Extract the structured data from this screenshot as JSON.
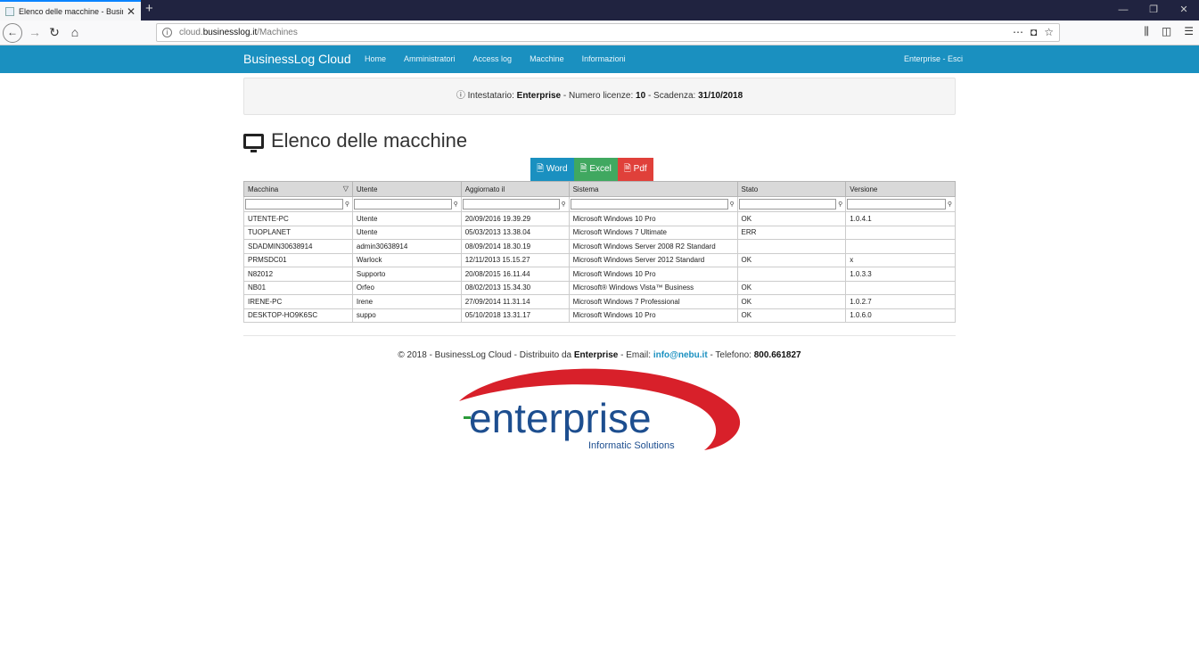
{
  "browser": {
    "tab_title": "Elenco delle macchine - Busine",
    "url_prefix": "cloud.",
    "url_domain": "businesslog.it",
    "url_path": "/Machines"
  },
  "site": {
    "brand": "BusinessLog Cloud",
    "menu": [
      "Home",
      "Amministratori",
      "Access log",
      "Macchine",
      "Informazioni"
    ],
    "user_link": "Enterprise - Esci"
  },
  "banner": {
    "label_holder": "Intestatario: ",
    "holder": "Enterprise",
    "label_licenses": " - Numero licenze: ",
    "licenses": "10",
    "label_expiry": " - Scadenza: ",
    "expiry": "31/10/2018"
  },
  "page": {
    "title": "Elenco delle macchine"
  },
  "exports": {
    "word": "Word",
    "excel": "Excel",
    "pdf": "Pdf"
  },
  "table": {
    "columns": [
      "Macchina",
      "Utente",
      "Aggiornato il",
      "Sistema",
      "Stato",
      "Versione"
    ],
    "rows": [
      [
        "UTENTE-PC",
        "Utente",
        "20/09/2016 19.39.29",
        "Microsoft Windows 10 Pro",
        "OK",
        "1.0.4.1"
      ],
      [
        "TUOPLANET",
        "Utente",
        "05/03/2013 13.38.04",
        "Microsoft Windows 7 Ultimate",
        "ERR",
        ""
      ],
      [
        "SDADMIN30638914",
        "admin30638914",
        "08/09/2014 18.30.19",
        "Microsoft Windows Server 2008 R2 Standard",
        "",
        ""
      ],
      [
        "PRMSDC01",
        "Warlock",
        "12/11/2013 15.15.27",
        "Microsoft Windows Server 2012 Standard",
        "OK",
        "x"
      ],
      [
        "N82012",
        "Supporto",
        "20/08/2015 16.11.44",
        "Microsoft Windows 10 Pro",
        "",
        "1.0.3.3"
      ],
      [
        "NB01",
        "Orfeo",
        "08/02/2013 15.34.30",
        "Microsoft® Windows Vista™ Business",
        "OK",
        ""
      ],
      [
        "IRENE-PC",
        "Irene",
        "27/09/2014 11.31.14",
        "Microsoft Windows 7 Professional",
        "OK",
        "1.0.2.7"
      ],
      [
        "DESKTOP-HO9K6SC",
        "suppo",
        "05/10/2018 13.31.17",
        "Microsoft Windows 10 Pro",
        "OK",
        "1.0.6.0"
      ]
    ]
  },
  "footer": {
    "prefix": "© 2018 - BusinessLog Cloud - Distribuito da ",
    "company": "Enterprise",
    "email_label": " - Email: ",
    "email": "info@nebu.it",
    "phone_label": " - Telefono: ",
    "phone": "800.661827"
  },
  "logo": {
    "name": "enterprise",
    "tagline": "Informatic Solutions"
  }
}
